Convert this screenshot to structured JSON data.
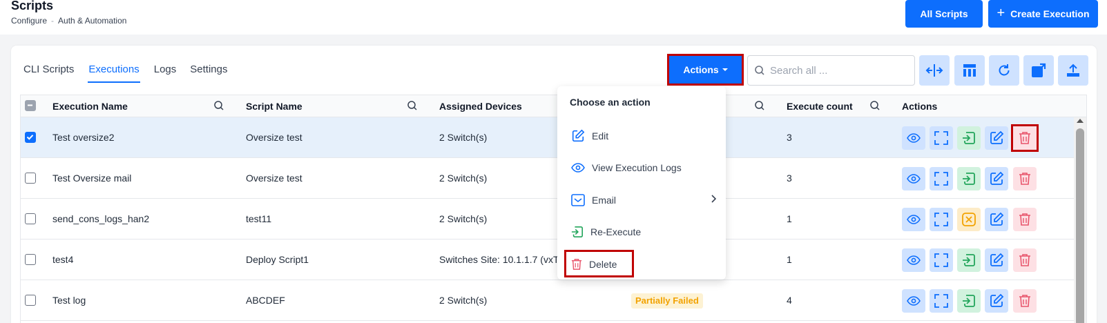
{
  "header": {
    "title": "Scripts",
    "breadcrumb": [
      "Configure",
      "Auth & Automation"
    ],
    "breadcrumb_sep": "-",
    "all_scripts_label": "All Scripts",
    "create_execution_label": "Create Execution"
  },
  "tabs": [
    {
      "label": "CLI Scripts",
      "active": false
    },
    {
      "label": "Executions",
      "active": true
    },
    {
      "label": "Logs",
      "active": false
    },
    {
      "label": "Settings",
      "active": false
    }
  ],
  "toolbar": {
    "actions_label": "Actions",
    "search_placeholder": "Search all ...",
    "tool_icons": [
      "resize-columns-icon",
      "column-layout-icon",
      "refresh-icon",
      "open-external-icon",
      "upload-icon"
    ]
  },
  "table": {
    "columns": {
      "execution_name": "Execution Name",
      "script_name": "Script Name",
      "assigned_devices": "Assigned Devices",
      "execute_count": "Execute count",
      "actions": "Actions"
    },
    "rows": [
      {
        "execution_name": "Test oversize2",
        "script_name": "Oversize test",
        "assigned_devices": "2 Switch(s)",
        "status": "",
        "execute_count": "3",
        "checked": true,
        "reexec_state": "re-execute"
      },
      {
        "execution_name": "Test Oversize mail",
        "script_name": "Oversize test",
        "assigned_devices": "2 Switch(s)",
        "status": "",
        "execute_count": "3",
        "checked": false,
        "reexec_state": "re-execute"
      },
      {
        "execution_name": "send_cons_logs_han2",
        "script_name": "test11",
        "assigned_devices": "2 Switch(s)",
        "status": "",
        "execute_count": "1",
        "checked": false,
        "reexec_state": "cancel"
      },
      {
        "execution_name": "test4",
        "script_name": "Deploy Script1",
        "assigned_devices": "Switches Site: 10.1.1.7 (vxTarg",
        "status": "",
        "execute_count": "1",
        "checked": false,
        "reexec_state": "re-execute"
      },
      {
        "execution_name": "Test log",
        "script_name": "ABCDEF",
        "assigned_devices": "2 Switch(s)",
        "status": "Partially Failed",
        "execute_count": "4",
        "checked": false,
        "reexec_state": "re-execute"
      }
    ]
  },
  "dropdown": {
    "title": "Choose an action",
    "items": [
      {
        "label": "Edit",
        "icon": "edit-icon"
      },
      {
        "label": "View Execution Logs",
        "icon": "eye-icon"
      },
      {
        "label": "Email",
        "icon": "mail-icon",
        "submenu": true
      },
      {
        "label": "Re-Execute",
        "icon": "re-execute-icon"
      },
      {
        "label": "Delete",
        "icon": "trash-icon"
      }
    ]
  },
  "colors": {
    "primary": "#0d6efd",
    "highlight": "#c00000",
    "success": "#22a55b",
    "warning": "#f2a200",
    "danger": "#e8546b"
  }
}
